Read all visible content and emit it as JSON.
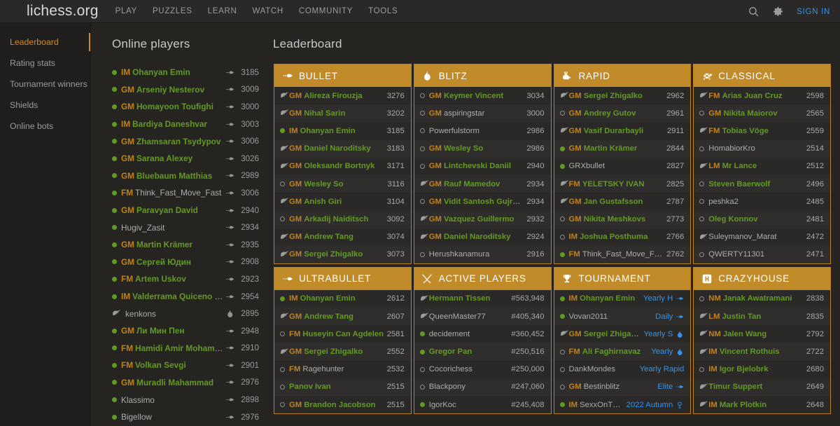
{
  "header": {
    "site_title": "lichess.org",
    "nav": [
      {
        "label": "PLAY",
        "name": "nav-play"
      },
      {
        "label": "PUZZLES",
        "name": "nav-puzzles"
      },
      {
        "label": "LEARN",
        "name": "nav-learn"
      },
      {
        "label": "WATCH",
        "name": "nav-watch"
      },
      {
        "label": "COMMUNITY",
        "name": "nav-community"
      },
      {
        "label": "TOOLS",
        "name": "nav-tools"
      }
    ],
    "search_icon": "search-icon",
    "settings_icon": "gear-icon",
    "signin_label": "SIGN IN"
  },
  "subnav": {
    "items": [
      {
        "label": "Leaderboard",
        "active": true
      },
      {
        "label": "Rating stats",
        "active": false
      },
      {
        "label": "Tournament winners",
        "active": false
      },
      {
        "label": "Shields",
        "active": false
      },
      {
        "label": "Online bots",
        "active": false
      }
    ]
  },
  "online_players": {
    "title": "Online players",
    "players": [
      {
        "status": "online",
        "title": "IM",
        "name": "Ohanyan Emin",
        "patron": false,
        "perf": "bullet",
        "rating": "3185"
      },
      {
        "status": "online",
        "title": "GM",
        "name": "Arseniy Nesterov",
        "patron": false,
        "perf": "bullet",
        "rating": "3009"
      },
      {
        "status": "online",
        "title": "GM",
        "name": "Homayoon Toufighi",
        "patron": false,
        "perf": "bullet",
        "rating": "3000"
      },
      {
        "status": "online",
        "title": "IM",
        "name": "Bardiya Daneshvar",
        "patron": false,
        "perf": "bullet",
        "rating": "3003"
      },
      {
        "status": "online",
        "title": "GM",
        "name": "Zhamsaran Tsydypov",
        "patron": false,
        "perf": "bullet",
        "rating": "3006"
      },
      {
        "status": "online",
        "title": "GM",
        "name": "Sarana Alexey",
        "patron": false,
        "perf": "bullet",
        "rating": "3026"
      },
      {
        "status": "online",
        "title": "GM",
        "name": "Bluebaum Matthias",
        "patron": false,
        "perf": "bullet",
        "rating": "2989"
      },
      {
        "status": "online",
        "title": "FM",
        "name": "Think_Fast_Move_Fast",
        "plain": true,
        "perf": "bullet",
        "rating": "3006"
      },
      {
        "status": "online",
        "title": "GM",
        "name": "Paravyan David",
        "patron": false,
        "perf": "bullet",
        "rating": "2940"
      },
      {
        "status": "online",
        "title": "",
        "name": "Hugiv_Zasit",
        "plain": true,
        "perf": "bullet",
        "rating": "2934"
      },
      {
        "status": "online",
        "title": "GM",
        "name": "Martin Krämer",
        "patron": false,
        "perf": "bullet",
        "rating": "2935"
      },
      {
        "status": "online",
        "title": "GM",
        "name": "Сергей Юдин",
        "patron": false,
        "perf": "bullet",
        "rating": "2908"
      },
      {
        "status": "online",
        "title": "FM",
        "name": "Artem Uskov",
        "patron": false,
        "perf": "bullet",
        "rating": "2923"
      },
      {
        "status": "online",
        "title": "IM",
        "name": "Valderrama Quiceno Esteban Alb",
        "patron": false,
        "perf": "bullet",
        "rating": "2954"
      },
      {
        "status": "patron",
        "title": "",
        "name": "kenkons",
        "plain": true,
        "perf": "blitz",
        "rating": "2895"
      },
      {
        "status": "online",
        "title": "GM",
        "name": "Ли Мин Пен",
        "patron": false,
        "perf": "bullet",
        "rating": "2948"
      },
      {
        "status": "online",
        "title": "FM",
        "name": "Hamidi Amir Mohammad",
        "patron": false,
        "perf": "bullet",
        "rating": "2910"
      },
      {
        "status": "online",
        "title": "FM",
        "name": "Volkan Sevgi",
        "patron": false,
        "perf": "bullet",
        "rating": "2901"
      },
      {
        "status": "online",
        "title": "GM",
        "name": "Muradli Mahammad",
        "patron": false,
        "perf": "bullet",
        "rating": "2976"
      },
      {
        "status": "online",
        "title": "",
        "name": "Klassimo",
        "plain": true,
        "perf": "bullet",
        "rating": "2898"
      },
      {
        "status": "online",
        "title": "",
        "name": "Bigellow",
        "plain": true,
        "perf": "bullet",
        "rating": "2976"
      }
    ]
  },
  "leaderboard": {
    "title": "Leaderboard",
    "cards": [
      {
        "key": "bullet",
        "heading": "BULLET",
        "icon": "bullet-icon",
        "value_kind": "rating",
        "rows": [
          {
            "status": "patron",
            "title": "GM",
            "name": "Alireza Firouzja",
            "value": "3276"
          },
          {
            "status": "patron",
            "title": "GM",
            "name": "Nihal Sarin",
            "value": "3202"
          },
          {
            "status": "online",
            "title": "IM",
            "name": "Ohanyan Emin",
            "value": "3185"
          },
          {
            "status": "patron",
            "title": "GM",
            "name": "Daniel Naroditsky",
            "value": "3183"
          },
          {
            "status": "patron",
            "title": "GM",
            "name": "Oleksandr Bortnyk",
            "value": "3171"
          },
          {
            "status": "offline",
            "title": "GM",
            "name": "Wesley So",
            "value": "3116"
          },
          {
            "status": "patron",
            "title": "GM",
            "name": "Anish Giri",
            "value": "3104"
          },
          {
            "status": "offline",
            "title": "GM",
            "name": "Arkadij Naiditsch",
            "value": "3092"
          },
          {
            "status": "patron",
            "title": "GM",
            "name": "Andrew Tang",
            "value": "3074"
          },
          {
            "status": "patron",
            "title": "GM",
            "name": "Sergei Zhigalko",
            "value": "3073"
          }
        ]
      },
      {
        "key": "blitz",
        "heading": "BLITZ",
        "icon": "flame-icon",
        "value_kind": "rating",
        "rows": [
          {
            "status": "offline",
            "title": "GM",
            "name": "Keymer Vincent",
            "value": "3034"
          },
          {
            "status": "offline",
            "title": "GM",
            "name": "aspiringstar",
            "plain": true,
            "value": "3000"
          },
          {
            "status": "offline",
            "title": "",
            "name": "Powerfulstorm",
            "plain": true,
            "value": "2986"
          },
          {
            "status": "offline",
            "title": "GM",
            "name": "Wesley So",
            "value": "2986"
          },
          {
            "status": "offline",
            "title": "GM",
            "name": "Lintchevski Daniil",
            "value": "2940"
          },
          {
            "status": "patron",
            "title": "GM",
            "name": "Rauf Mamedov",
            "value": "2934"
          },
          {
            "status": "offline",
            "title": "GM",
            "name": "Vidit Santosh Gujrathi",
            "value": "2934"
          },
          {
            "status": "patron",
            "title": "GM",
            "name": "Vazquez Guillermo",
            "value": "2932"
          },
          {
            "status": "patron",
            "title": "GM",
            "name": "Daniel Naroditsky",
            "value": "2924"
          },
          {
            "status": "offline",
            "title": "",
            "name": "Herushkanamura",
            "plain": true,
            "value": "2916"
          }
        ]
      },
      {
        "key": "rapid",
        "heading": "RAPID",
        "icon": "rabbit-icon",
        "value_kind": "rating",
        "rows": [
          {
            "status": "patron",
            "title": "GM",
            "name": "Sergei Zhigalko",
            "value": "2962"
          },
          {
            "status": "offline",
            "title": "GM",
            "name": "Andrey Gutov",
            "value": "2961"
          },
          {
            "status": "patron",
            "title": "GM",
            "name": "Vasif Durarbayli",
            "value": "2911"
          },
          {
            "status": "online",
            "title": "GM",
            "name": "Martin Krämer",
            "value": "2844"
          },
          {
            "status": "online",
            "title": "",
            "name": "GRXbullet",
            "plain": true,
            "value": "2827"
          },
          {
            "status": "patron",
            "title": "FM",
            "name": "YELETSKY IVAN",
            "value": "2825"
          },
          {
            "status": "patron",
            "title": "GM",
            "name": "Jan Gustafsson",
            "value": "2787"
          },
          {
            "status": "offline",
            "title": "GM",
            "name": "Nikita Meshkovs",
            "value": "2773"
          },
          {
            "status": "offline",
            "title": "IM",
            "name": "Joshua Posthuma",
            "value": "2766"
          },
          {
            "status": "online",
            "title": "FM",
            "name": "Think_Fast_Move_Fast",
            "plain": true,
            "value": "2762"
          }
        ]
      },
      {
        "key": "classical",
        "heading": "CLASSICAL",
        "icon": "turtle-icon",
        "value_kind": "rating",
        "rows": [
          {
            "status": "patron",
            "title": "FM",
            "name": "Arias Juan Cruz",
            "value": "2598"
          },
          {
            "status": "offline",
            "title": "GM",
            "name": "Nikita Maiorov",
            "value": "2565"
          },
          {
            "status": "patron",
            "title": "FM",
            "name": "Tobias Vöge",
            "value": "2559"
          },
          {
            "status": "offline",
            "title": "",
            "name": "HomabiorKro",
            "plain": true,
            "value": "2514"
          },
          {
            "status": "patron",
            "title": "LM",
            "name": "Mr Lance",
            "value": "2512"
          },
          {
            "status": "offline",
            "title": "",
            "name": "Steven Baerwolf",
            "value": "2496"
          },
          {
            "status": "offline",
            "title": "",
            "name": "peshka2",
            "plain": true,
            "value": "2485"
          },
          {
            "status": "offline",
            "title": "",
            "name": "Oleg Konnov",
            "value": "2481"
          },
          {
            "status": "patron",
            "title": "",
            "name": "Suleymanov_Marat",
            "plain": true,
            "value": "2472"
          },
          {
            "status": "offline",
            "title": "",
            "name": "QWERTY11301",
            "plain": true,
            "value": "2471"
          }
        ]
      },
      {
        "key": "ultrabullet",
        "heading": "ULTRABULLET",
        "icon": "ultrabullet-icon",
        "value_kind": "rating",
        "rows": [
          {
            "status": "online",
            "title": "IM",
            "name": "Ohanyan Emin",
            "value": "2612"
          },
          {
            "status": "patron",
            "title": "GM",
            "name": "Andrew Tang",
            "value": "2607"
          },
          {
            "status": "offline",
            "title": "FM",
            "name": "Huseyin Can Agdelen",
            "value": "2581"
          },
          {
            "status": "patron",
            "title": "GM",
            "name": "Sergei Zhigalko",
            "value": "2552"
          },
          {
            "status": "offline",
            "title": "FM",
            "name": "Ragehunter",
            "plain": true,
            "value": "2532"
          },
          {
            "status": "offline",
            "title": "",
            "name": "Panov Ivan",
            "value": "2515"
          },
          {
            "status": "offline",
            "title": "GM",
            "name": "Brandon Jacobson",
            "value": "2515"
          }
        ]
      },
      {
        "key": "active_players",
        "heading": "ACTIVE PLAYERS",
        "icon": "swords-icon",
        "value_kind": "rank",
        "rows": [
          {
            "status": "patron",
            "title": "",
            "name": "Hermann Tissen",
            "value": "#563,948"
          },
          {
            "status": "patron",
            "title": "",
            "name": "QueenMaster77",
            "plain": true,
            "value": "#405,340"
          },
          {
            "status": "online",
            "title": "",
            "name": "decidement",
            "plain": true,
            "value": "#360,452"
          },
          {
            "status": "online",
            "title": "",
            "name": "Gregor Pan",
            "value": "#250,516"
          },
          {
            "status": "offline",
            "title": "",
            "name": "Cocorichess",
            "plain": true,
            "value": "#250,000"
          },
          {
            "status": "offline",
            "title": "",
            "name": "Blackpony",
            "plain": true,
            "value": "#247,060"
          },
          {
            "status": "online",
            "title": "",
            "name": "IgorKoc",
            "plain": true,
            "value": "#245,408"
          }
        ]
      },
      {
        "key": "tournament",
        "heading": "TOURNAMENT",
        "icon": "trophy-icon",
        "value_kind": "tournament",
        "rows": [
          {
            "status": "online",
            "title": "IM",
            "name": "Ohanyan Emin",
            "tourney": "Yearly H",
            "ticon": "bullet-icon"
          },
          {
            "status": "online",
            "title": "",
            "name": "Vovan2011",
            "plain": true,
            "tourney": "Daily",
            "ticon": "bullet-icon"
          },
          {
            "status": "patron",
            "title": "GM",
            "name": "Sergei Zhigalko",
            "tourney": "Yearly S",
            "ticon": "flame-icon"
          },
          {
            "status": "offline",
            "title": "FM",
            "name": "Ali Faghirnavaz",
            "tourney": "Yearly",
            "ticon": "flame-icon"
          },
          {
            "status": "offline",
            "title": "",
            "name": "DankMondes",
            "plain": true,
            "tourney": "Yearly Rapid",
            "ticon": ""
          },
          {
            "status": "offline",
            "title": "GM",
            "name": "Bestinblitz",
            "plain": true,
            "tourney": "Elite",
            "ticon": "bullet-icon"
          },
          {
            "status": "online",
            "title": "IM",
            "name": "SexxOnTheBea…",
            "plain": true,
            "tourney": "2022 Autumn",
            "ticon": "crazyhouse-icon"
          }
        ]
      },
      {
        "key": "crazyhouse",
        "heading": "CRAZYHOUSE",
        "icon": "crazyhouse-box-icon",
        "value_kind": "rating",
        "rows": [
          {
            "status": "offline",
            "title": "NM",
            "name": "Janak Awatramani",
            "value": "2838"
          },
          {
            "status": "patron",
            "title": "LM",
            "name": "Justin Tan",
            "value": "2835"
          },
          {
            "status": "patron",
            "title": "NM",
            "name": "Jalen Wang",
            "value": "2792"
          },
          {
            "status": "patron",
            "title": "IM",
            "name": "Vincent Rothuis",
            "value": "2722"
          },
          {
            "status": "offline",
            "title": "IM",
            "name": "Igor Bjelobrk",
            "value": "2680"
          },
          {
            "status": "patron",
            "title": "",
            "name": "Timur Suppert",
            "value": "2649"
          },
          {
            "status": "patron",
            "title": "IM",
            "name": "Mark Plotkin",
            "value": "2648"
          }
        ]
      }
    ]
  },
  "colors": {
    "accent": "#bf811e",
    "header_bg": "#c08b28",
    "link": "#3692e7",
    "green": "#629924",
    "page_bg": "#262421"
  }
}
